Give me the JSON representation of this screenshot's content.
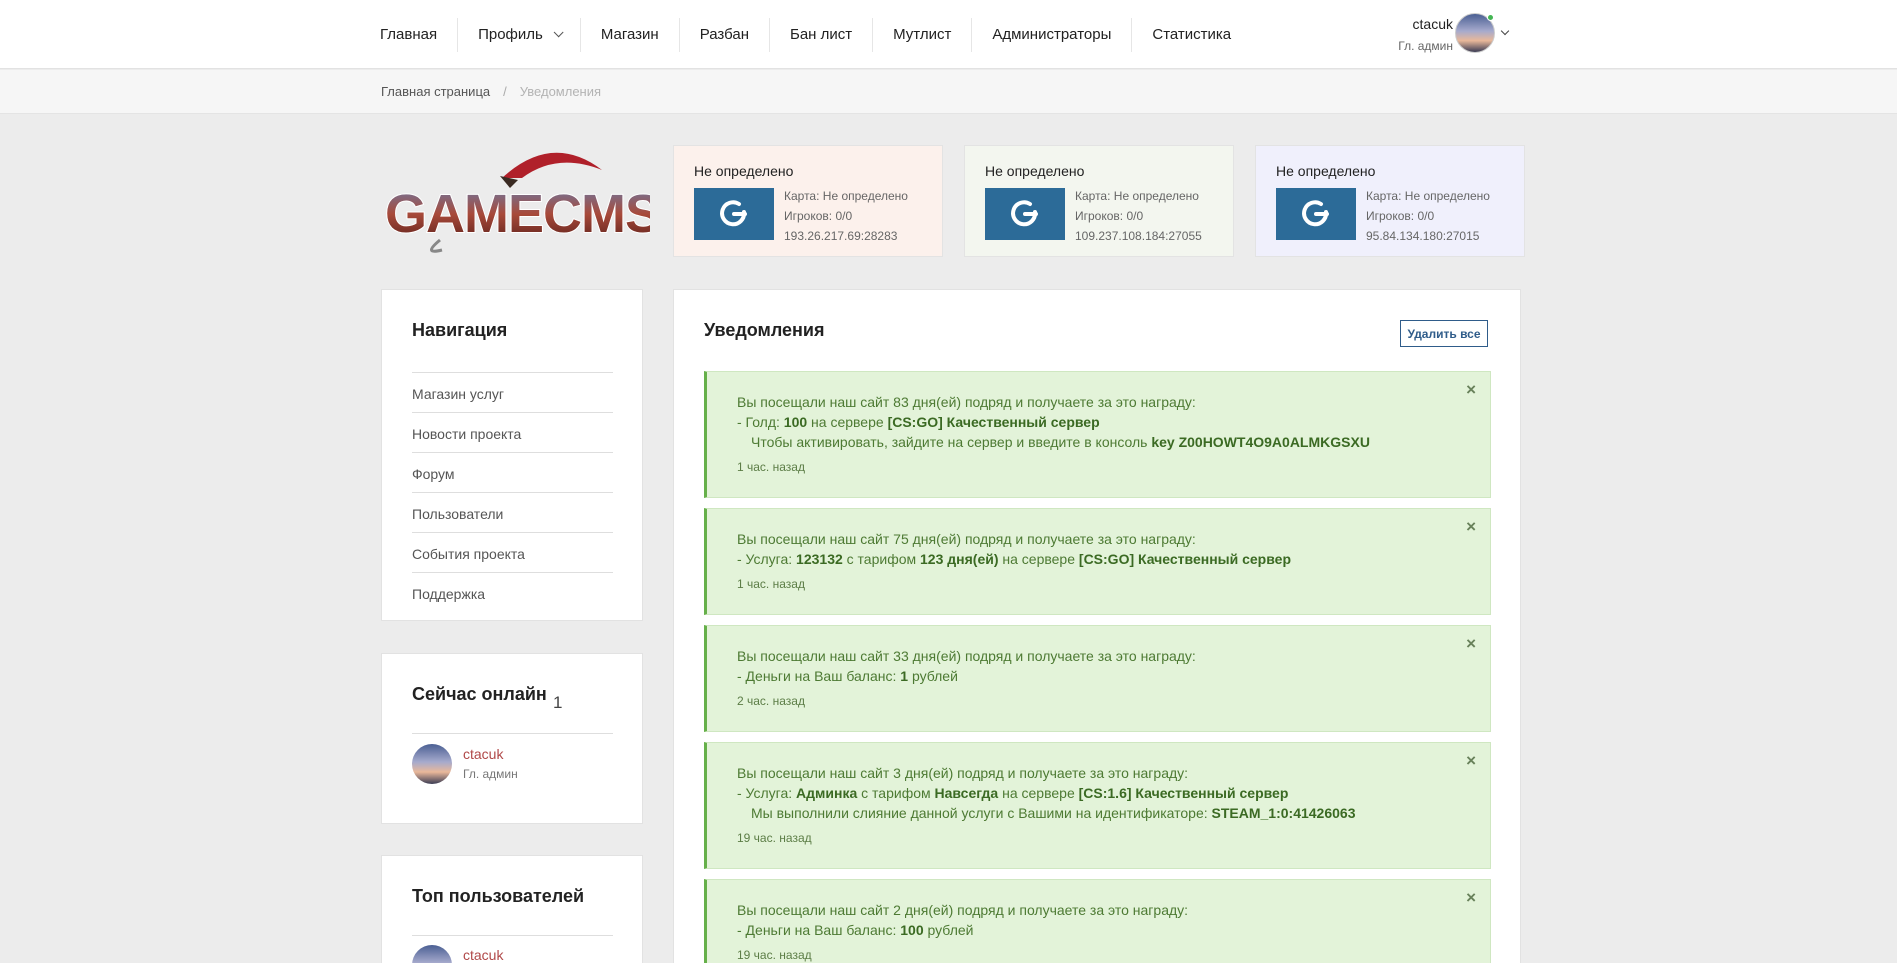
{
  "nav": {
    "items": [
      "Главная",
      "Профиль",
      "Магазин",
      "Разбан",
      "Бан лист",
      "Мутлист",
      "Администраторы",
      "Статистика"
    ],
    "user": {
      "name": "ctacuk",
      "role": "Гл. админ"
    }
  },
  "breadcrumb": {
    "home": "Главная страница",
    "sep": "/",
    "current": "Уведомления"
  },
  "logo": {
    "text": "GAMECMS"
  },
  "servers": [
    {
      "name": "Не определено",
      "map": "Карта: Не определено",
      "players": "Игроков: 0/0",
      "address": "193.26.217.69:28283",
      "bg": "#fcf1ec"
    },
    {
      "name": "Не определено",
      "map": "Карта: Не определено",
      "players": "Игроков: 0/0",
      "address": "109.237.108.184:27055",
      "bg": "#f3f6ef"
    },
    {
      "name": "Не определено",
      "map": "Карта: Не определено",
      "players": "Игроков: 0/0",
      "address": "95.84.134.180:27015",
      "bg": "#f0f0fc"
    }
  ],
  "sidebar": {
    "nav_title": "Навигация",
    "nav_items": [
      "Магазин услуг",
      "Новости проекта",
      "Форум",
      "Пользователи",
      "События проекта",
      "Поддержка"
    ],
    "online_title": "Сейчас онлайн",
    "online_count": "1",
    "online_user": {
      "name": "ctacuk",
      "role": "Гл. админ"
    },
    "top_title": "Топ пользователей",
    "top_user": {
      "name": "ctacuk"
    }
  },
  "main": {
    "title": "Уведомления",
    "delete_all": "Удалить все",
    "close_symbol": "×",
    "notifications": [
      {
        "line1": "Вы посещали наш сайт 83 дня(ей) подряд и получаете за это награду:",
        "line2a": "- Голд: ",
        "line2b": "100",
        "line2c": " на сервере ",
        "line2d": "[CS:GO] Качественный сервер",
        "line3a": "Чтобы активировать, зайдите на сервер и введите в консоль ",
        "line3b": "key Z00HOWT4O9A0ALMKGSXU",
        "time": "1 час. назад"
      },
      {
        "line1": "Вы посещали наш сайт 75 дня(ей) подряд и получаете за это награду:",
        "line2a": "- Услуга: ",
        "line2b": "123132",
        "line2c": " с тарифом ",
        "line2d": "123 дня(ей)",
        "line2e": " на сервере ",
        "line2f": "[CS:GO] Качественный сервер",
        "time": "1 час. назад"
      },
      {
        "line1": "Вы посещали наш сайт 33 дня(ей) подряд и получаете за это награду:",
        "line2a": "- Деньги на Ваш баланс: ",
        "line2b": "1",
        "line2c": " рублей",
        "time": "2 час. назад"
      },
      {
        "line1": "Вы посещали наш сайт 3 дня(ей) подряд и получаете за это награду:",
        "line2a": "- Услуга: ",
        "line2b": "Админка",
        "line2c": " с тарифом ",
        "line2d": "Навсегда",
        "line2e": " на сервере ",
        "line2f": "[CS:1.6] Качественный сервер",
        "line3a": "Мы выполнили слияние данной услуги с Вашими на идентификаторе: ",
        "line3b": "STEAM_1:0:41426063",
        "time": "19 час. назад"
      },
      {
        "line1": "Вы посещали наш сайт 2 дня(ей) подряд и получаете за это награду:",
        "line2a": "- Деньги на Ваш баланс: ",
        "line2b": "100",
        "line2c": " рублей",
        "time": "19 час. назад"
      }
    ]
  }
}
